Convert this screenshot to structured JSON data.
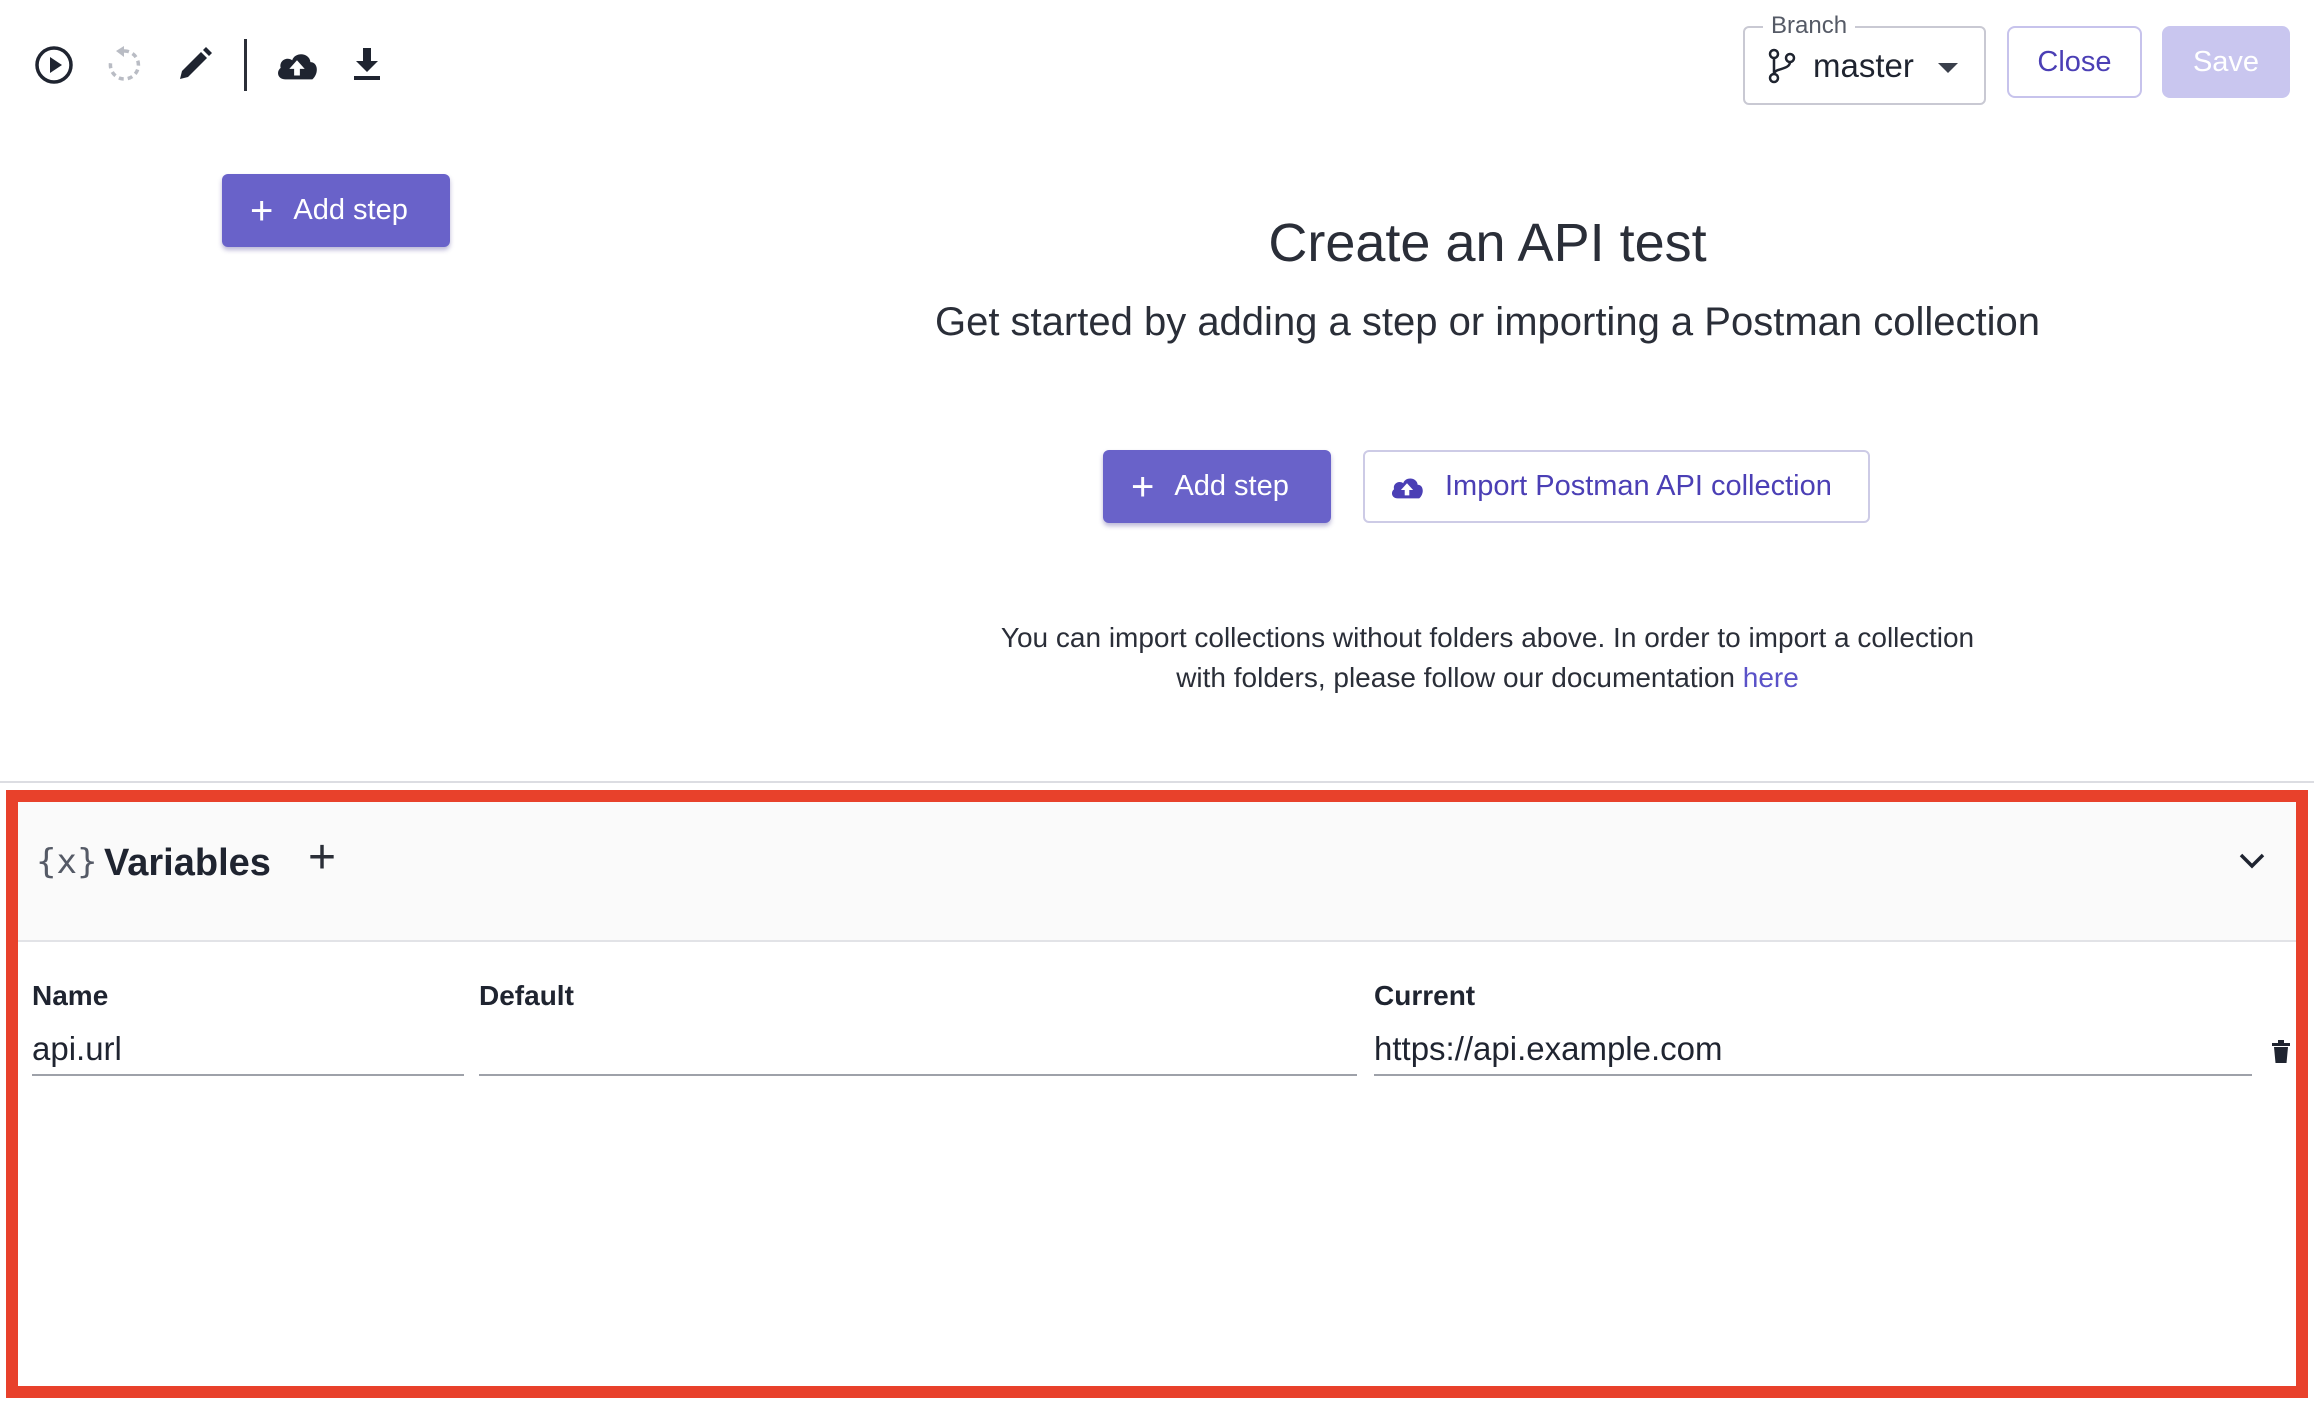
{
  "toolbar": {
    "icons": [
      "play-circle-icon",
      "refresh-icon",
      "pencil-icon",
      "cloud-upload-icon",
      "download-icon"
    ]
  },
  "branch": {
    "label": "Branch",
    "value": "master"
  },
  "header_buttons": {
    "close": "Close",
    "save": "Save"
  },
  "add_step_label": "Add step",
  "empty_state": {
    "title": "Create an API test",
    "subtitle": "Get started by adding a step or importing a Postman collection",
    "add_step": "Add step",
    "import": "Import Postman API collection",
    "note_text": "You can import collections without folders above. In order to import a collection with folders, please follow our documentation ",
    "note_link": "here"
  },
  "variables": {
    "icon_text": "{x}",
    "title": "Variables",
    "add_symbol": "+",
    "columns": {
      "name": "Name",
      "default": "Default",
      "current": "Current"
    },
    "rows": [
      {
        "name": "api.url",
        "default": "",
        "current": "https://api.example.com"
      }
    ]
  },
  "colors": {
    "accent": "#6962c9",
    "highlight": "#e8412b",
    "link": "#5a52c8"
  }
}
